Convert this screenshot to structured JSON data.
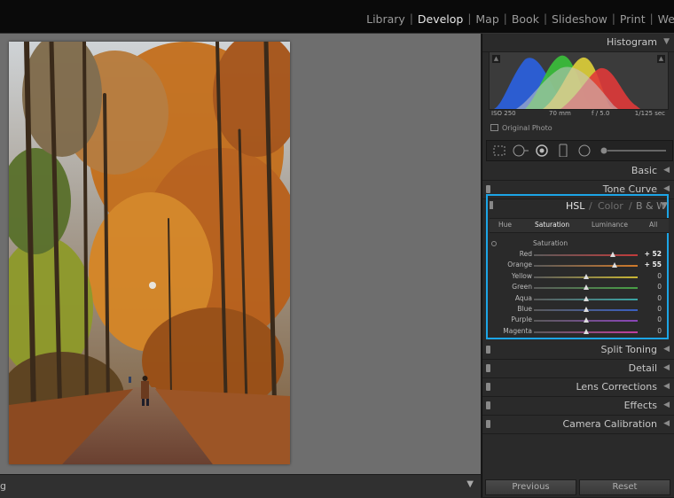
{
  "modules": [
    "Library",
    "Develop",
    "Map",
    "Book",
    "Slideshow",
    "Print",
    "We"
  ],
  "active_module": "Develop",
  "bottom_bar": {
    "left_text": "g",
    "dropdown_icon": "triangle-down-icon"
  },
  "panels": {
    "histogram": {
      "title": "Histogram",
      "iso": "ISO 250",
      "focal": "70 mm",
      "aperture": "f / 5.0",
      "shutter": "1/125 sec",
      "original_photo_label": "Original Photo"
    },
    "basic": "Basic",
    "tone_curve": "Tone Curve",
    "hsl": {
      "title_hsl": "HSL",
      "sep": "/",
      "title_color": "Color",
      "title_bw": "B & W",
      "tabs": [
        "Hue",
        "Saturation",
        "Luminance",
        "All"
      ],
      "active_tab": "Saturation",
      "section_title": "Saturation",
      "sliders": [
        {
          "label": "Red",
          "value": "+ 52",
          "num": 52,
          "color": "#c23b3b"
        },
        {
          "label": "Orange",
          "value": "+ 55",
          "num": 55,
          "color": "#d07a2a"
        },
        {
          "label": "Yellow",
          "value": "0",
          "num": 0,
          "color": "#c9b634"
        },
        {
          "label": "Green",
          "value": "0",
          "num": 0,
          "color": "#47a045"
        },
        {
          "label": "Aqua",
          "value": "0",
          "num": 0,
          "color": "#3aa6a6"
        },
        {
          "label": "Blue",
          "value": "0",
          "num": 0,
          "color": "#3a5fc2"
        },
        {
          "label": "Purple",
          "value": "0",
          "num": 0,
          "color": "#8a45b8"
        },
        {
          "label": "Magenta",
          "value": "0",
          "num": 0,
          "color": "#c23e9e"
        }
      ]
    },
    "split_toning": "Split Toning",
    "detail": "Detail",
    "lens_corrections": "Lens Corrections",
    "effects": "Effects",
    "camera_calibration": "Camera Calibration"
  },
  "buttons": {
    "previous": "Previous",
    "reset": "Reset"
  },
  "accent_color": "#1ca5e6"
}
